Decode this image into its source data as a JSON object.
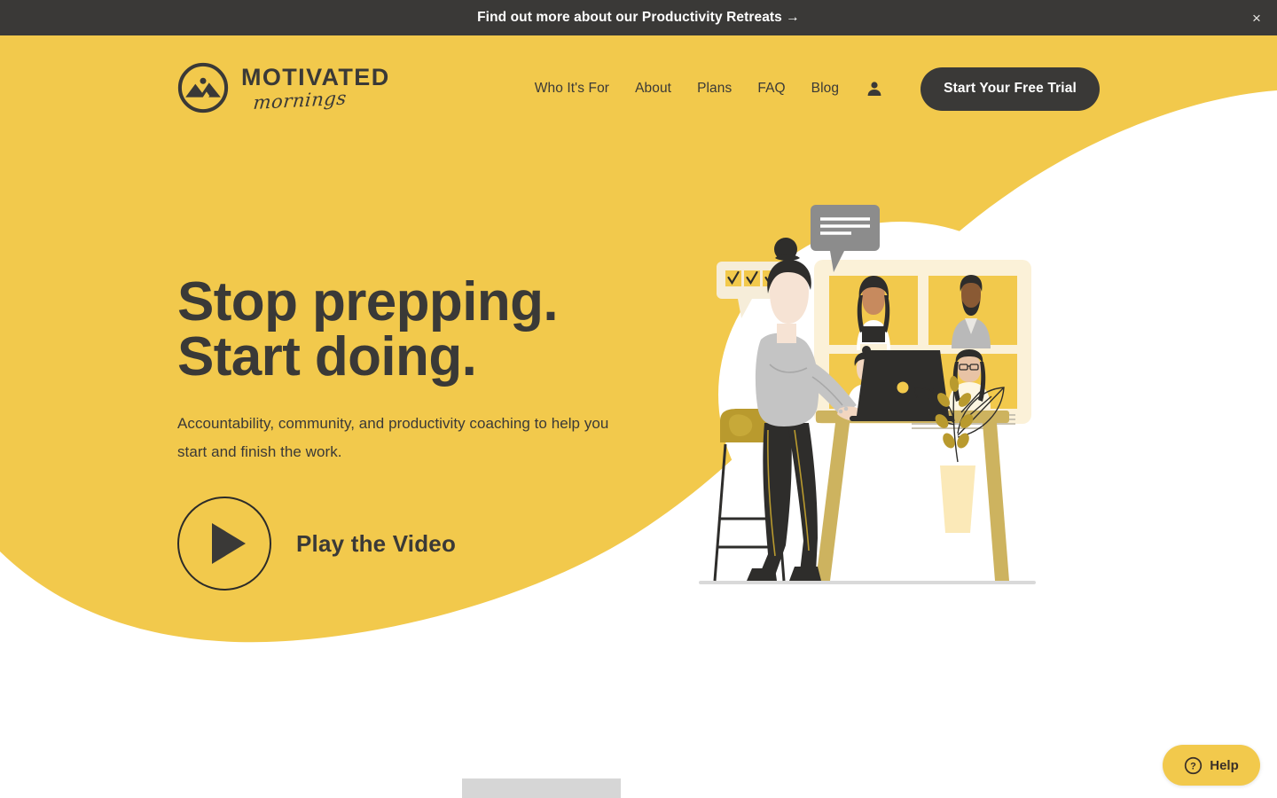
{
  "banner": {
    "text": "Find out more about our Productivity Retreats →",
    "close_label": "×",
    "bg_color": "#3a3937",
    "text_color": "#ffffff"
  },
  "brand": {
    "name": "MOTIVATED",
    "tagline": "mornings",
    "logo_icon": "mountain-circle-icon"
  },
  "nav": {
    "items": [
      {
        "label": "Who It's For"
      },
      {
        "label": "About"
      },
      {
        "label": "Plans"
      },
      {
        "label": "FAQ"
      },
      {
        "label": "Blog"
      }
    ],
    "account_icon": "person-icon",
    "cta_label": "Start Your Free Trial"
  },
  "hero": {
    "title_line1": "Stop prepping.",
    "title_line2": "Start doing.",
    "subtitle": "Accountability, community, and productivity coaching to help you start and finish the work.",
    "play_label": "Play the Video",
    "play_icon": "play-triangle-icon",
    "bg_color": "#f2c94c",
    "text_color": "#3a3937"
  },
  "illustration": {
    "name": "woman-at-laptop-video-call-illustration",
    "speech_bubble_lines": 3,
    "checkmarks": 3,
    "video_participants": 4,
    "colors": {
      "yellow": "#f2c94c",
      "cream": "#fbf1d8",
      "gray": "#8c8c8c",
      "dark": "#2e2d2b",
      "olive": "#b99a2e"
    }
  },
  "help": {
    "label": "Help",
    "icon": "question-circle-icon",
    "bg_color": "#f2c94c"
  }
}
